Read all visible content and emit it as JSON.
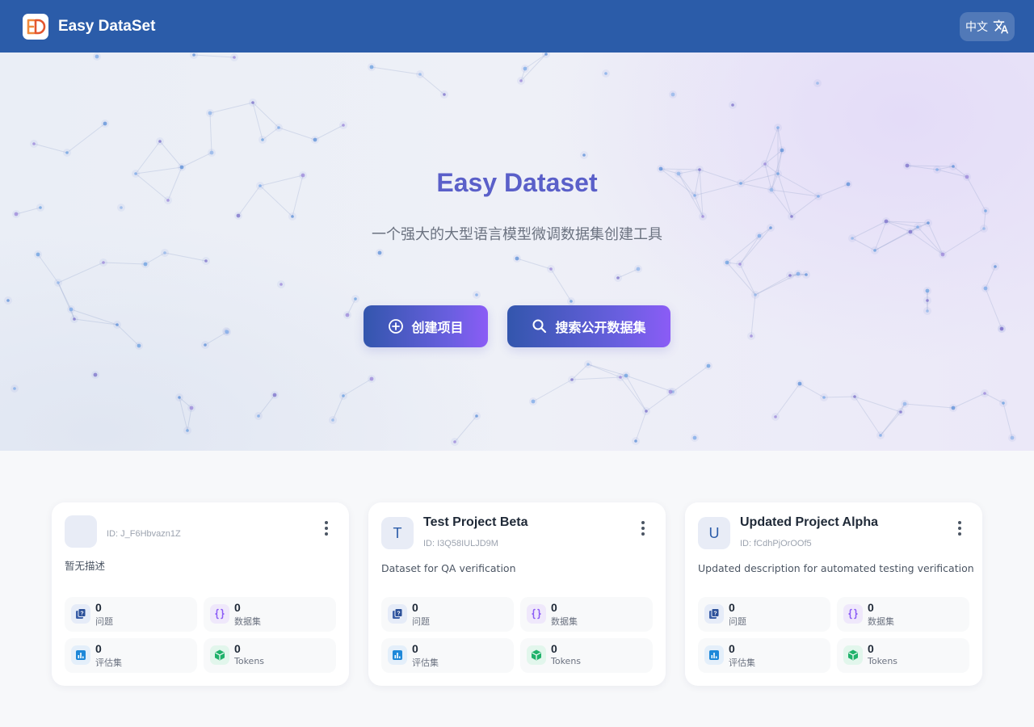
{
  "header": {
    "app_title": "Easy DataSet",
    "lang_label": "中文",
    "lang_icon": "translate-icon",
    "logo": "easy-dataset-logo"
  },
  "hero": {
    "title": "Easy Dataset",
    "subtitle": "一个强大的大型语言模型微调数据集创建工具",
    "create_label": "创建项目",
    "search_label": "搜索公开数据集"
  },
  "projects": [
    {
      "name": "",
      "initial": "",
      "id": "ID: J_F6Hbvazn1Z",
      "description": "暂无描述",
      "stats": [
        {
          "value": "0",
          "label": "问题"
        },
        {
          "value": "0",
          "label": "数据集"
        },
        {
          "value": "0",
          "label": "评估集"
        },
        {
          "value": "0",
          "label": "Tokens"
        }
      ]
    },
    {
      "name": "Test Project Beta",
      "initial": "T",
      "id": "ID: I3Q58IULJD9M",
      "description": "Dataset for QA verification",
      "stats": [
        {
          "value": "0",
          "label": "问题"
        },
        {
          "value": "0",
          "label": "数据集"
        },
        {
          "value": "0",
          "label": "评估集"
        },
        {
          "value": "0",
          "label": "Tokens"
        }
      ]
    },
    {
      "name": "Updated Project Alpha",
      "initial": "U",
      "id": "ID: fCdhPjOrOOf5",
      "description": "Updated description for automated testing verification",
      "stats": [
        {
          "value": "0",
          "label": "问题"
        },
        {
          "value": "0",
          "label": "数据集"
        },
        {
          "value": "0",
          "label": "评估集"
        },
        {
          "value": "0",
          "label": "Tokens"
        }
      ]
    }
  ],
  "colors": {
    "header": "#2b5ca9",
    "hero_title": "#5a5fc9",
    "button_start": "#3356ad",
    "button_end": "#8b5cf6"
  }
}
